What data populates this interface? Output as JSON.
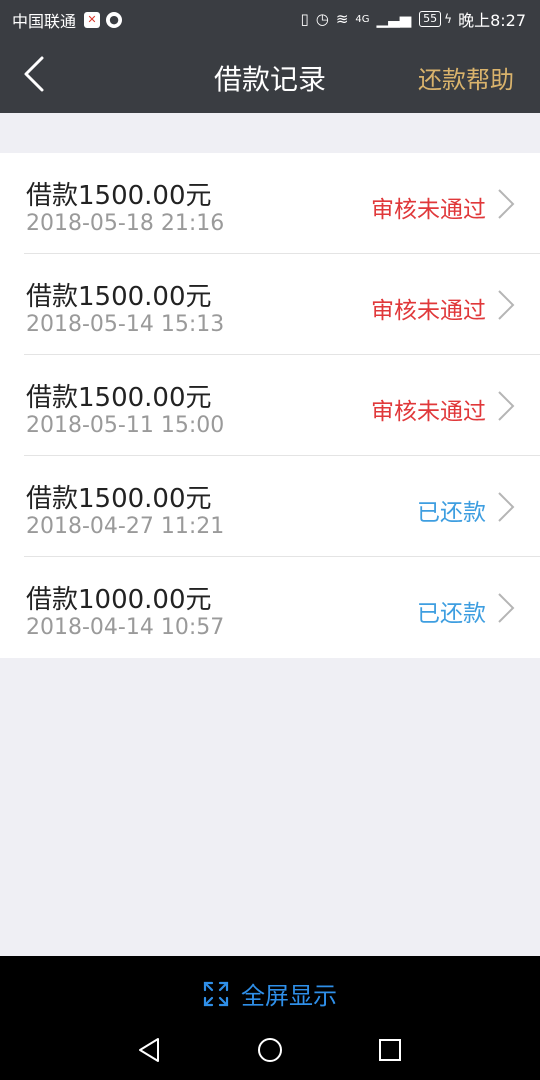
{
  "status_bar": {
    "carrier": "中国联通",
    "battery": "55",
    "time": "晚上8:27",
    "network": "4G"
  },
  "header": {
    "title": "借款记录",
    "help_label": "还款帮助"
  },
  "records": [
    {
      "amount": "借款1500.00元",
      "date": "2018-05-18 21:16",
      "status": "审核未通过",
      "status_type": "rejected"
    },
    {
      "amount": "借款1500.00元",
      "date": "2018-05-14 15:13",
      "status": "审核未通过",
      "status_type": "rejected"
    },
    {
      "amount": "借款1500.00元",
      "date": "2018-05-11 15:00",
      "status": "审核未通过",
      "status_type": "rejected"
    },
    {
      "amount": "借款1500.00元",
      "date": "2018-04-27 11:21",
      "status": "已还款",
      "status_type": "repaid"
    },
    {
      "amount": "借款1000.00元",
      "date": "2018-04-14 10:57",
      "status": "已还款",
      "status_type": "repaid"
    }
  ],
  "footer": {
    "fullscreen_label": "全屏显示"
  },
  "colors": {
    "header_bg": "#3a3d42",
    "help_color": "#d9b36c",
    "rejected": "#e0383a",
    "repaid": "#3e9ee0"
  },
  "icons": [
    "back-icon",
    "chevron-right-icon",
    "fullscreen-icon",
    "nav-back-icon",
    "nav-home-icon",
    "nav-recent-icon"
  ]
}
